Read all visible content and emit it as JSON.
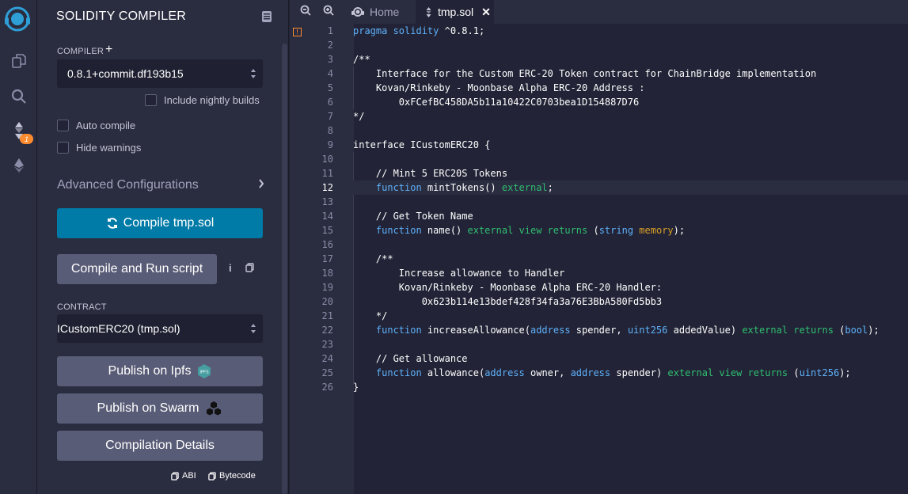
{
  "panel": {
    "title": "SOLIDITY COMPILER",
    "compiler_label": "COMPILER",
    "compiler_version": "0.8.1+commit.df193b15",
    "include_nightly": "Include nightly builds",
    "auto_compile": "Auto compile",
    "hide_warnings": "Hide warnings",
    "advanced": "Advanced Configurations",
    "compile_btn": "Compile tmp.sol",
    "compile_run_btn": "Compile and Run script",
    "contract_label": "CONTRACT",
    "contract_value": "ICustomERC20 (tmp.sol)",
    "publish_ipfs": "Publish on Ipfs",
    "ipfs_badge": "IPFS",
    "publish_swarm": "Publish on Swarm",
    "compilation_details": "Compilation Details",
    "abi": "ABI",
    "bytecode": "Bytecode"
  },
  "rail": {
    "badge_count": "1"
  },
  "editor": {
    "tabs": [
      {
        "label": "Home"
      },
      {
        "label": "tmp.sol",
        "active": true
      }
    ],
    "warning_marker": "!",
    "active_line": 12,
    "lines": [
      "1",
      "2",
      "3",
      "4",
      "5",
      "6",
      "7",
      "8",
      "9",
      "10",
      "11",
      "12",
      "13",
      "14",
      "15",
      "16",
      "17",
      "18",
      "19",
      "20",
      "21",
      "22",
      "23",
      "24",
      "25",
      "26"
    ],
    "code": {
      "l1a": "pragma solidity",
      "l1b": " ^0.8.1;",
      "l3": "/**",
      "l4": "    Interface for the Custom ERC-20 Token contract for ChainBridge implementation",
      "l5": "    Kovan/Rinkeby - Moonbase Alpha ERC-20 Address :",
      "l6": "        0xFCefBC458DA5b11a10422C0703bea1D154887D76",
      "l7": "*/",
      "l9": "interface ICustomERC20 {",
      "l11": "    // Mint 5 ERC20S Tokens",
      "fn": "function",
      "l12name": " mintTokens() ",
      "external": "external",
      "semi": ";",
      "l14": "    // Get Token Name",
      "l15name": " name() ",
      "view": "view",
      "returns": "returns",
      "l15open": " (",
      "string": "string",
      "memory": "memory",
      "l15close": ");",
      "l17": "    /**",
      "l18": "        Increase allowance to Handler",
      "l19": "        Kovan/Rinkeby - Moonbase Alpha ERC-20 Handler:",
      "l20": "            0x623b114e13bdef428f34fa3a76E3BbA580Fd5bb3",
      "l21": "    */",
      "l22name": " increaseAllowance(",
      "address": "address",
      "spender": " spender, ",
      "uint256": "uint256",
      "addedValue": " addedValue) ",
      "bool": "bool",
      "l24": "    // Get allowance",
      "l25name": " allowance(",
      "owner": " owner, ",
      "spender2": " spender) ",
      "l26": "}"
    }
  }
}
